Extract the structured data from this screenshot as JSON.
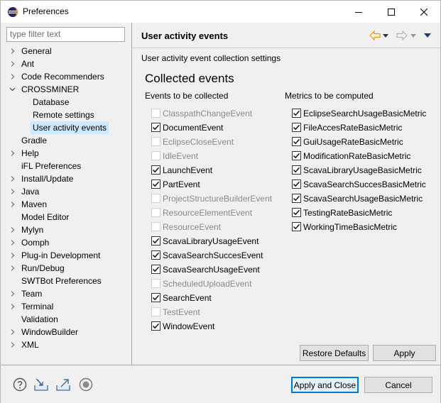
{
  "window": {
    "title": "Preferences",
    "min_symbol": "—",
    "max_symbol": "☐",
    "close_symbol": "✕"
  },
  "filter": {
    "placeholder": "type filter text"
  },
  "tree": {
    "items": [
      {
        "label": "General",
        "expander": "collapsed",
        "level": 0
      },
      {
        "label": "Ant",
        "expander": "collapsed",
        "level": 0
      },
      {
        "label": "Code Recommenders",
        "expander": "collapsed",
        "level": 0
      },
      {
        "label": "CROSSMINER",
        "expander": "expanded",
        "level": 0
      },
      {
        "label": "Database",
        "expander": "none",
        "level": 1
      },
      {
        "label": "Remote settings",
        "expander": "none",
        "level": 1
      },
      {
        "label": "User activity events",
        "expander": "none",
        "level": 1,
        "selected": true
      },
      {
        "label": "Gradle",
        "expander": "none",
        "level": 0
      },
      {
        "label": "Help",
        "expander": "collapsed",
        "level": 0
      },
      {
        "label": "iFL Preferences",
        "expander": "none",
        "level": 0
      },
      {
        "label": "Install/Update",
        "expander": "collapsed",
        "level": 0
      },
      {
        "label": "Java",
        "expander": "collapsed",
        "level": 0
      },
      {
        "label": "Maven",
        "expander": "collapsed",
        "level": 0
      },
      {
        "label": "Model Editor",
        "expander": "none",
        "level": 0
      },
      {
        "label": "Mylyn",
        "expander": "collapsed",
        "level": 0
      },
      {
        "label": "Oomph",
        "expander": "collapsed",
        "level": 0
      },
      {
        "label": "Plug-in Development",
        "expander": "collapsed",
        "level": 0
      },
      {
        "label": "Run/Debug",
        "expander": "collapsed",
        "level": 0
      },
      {
        "label": "SWTBot Preferences",
        "expander": "none",
        "level": 0
      },
      {
        "label": "Team",
        "expander": "collapsed",
        "level": 0
      },
      {
        "label": "Terminal",
        "expander": "collapsed",
        "level": 0
      },
      {
        "label": "Validation",
        "expander": "none",
        "level": 0
      },
      {
        "label": "WindowBuilder",
        "expander": "collapsed",
        "level": 0
      },
      {
        "label": "XML",
        "expander": "collapsed",
        "level": 0
      }
    ]
  },
  "page": {
    "title": "User activity events",
    "description": "User activity event collection settings",
    "group_title": "Collected events",
    "events_heading": "Events to be collected",
    "metrics_heading": "Metrics to be computed",
    "events": [
      {
        "label": "ClasspathChangeEvent",
        "checked": false,
        "enabled": false
      },
      {
        "label": "DocumentEvent",
        "checked": true,
        "enabled": true
      },
      {
        "label": "EclipseCloseEvent",
        "checked": false,
        "enabled": false
      },
      {
        "label": "IdleEvent",
        "checked": false,
        "enabled": false
      },
      {
        "label": "LaunchEvent",
        "checked": true,
        "enabled": true
      },
      {
        "label": "PartEvent",
        "checked": true,
        "enabled": true
      },
      {
        "label": "ProjectStructureBuilderEvent",
        "checked": false,
        "enabled": false
      },
      {
        "label": "ResourceElementEvent",
        "checked": false,
        "enabled": false
      },
      {
        "label": "ResourceEvent",
        "checked": false,
        "enabled": false
      },
      {
        "label": "ScavaLibraryUsageEvent",
        "checked": true,
        "enabled": true
      },
      {
        "label": "ScavaSearchSuccesEvent",
        "checked": true,
        "enabled": true
      },
      {
        "label": "ScavaSearchUsageEvent",
        "checked": true,
        "enabled": true
      },
      {
        "label": "ScheduledUploadEvent",
        "checked": false,
        "enabled": false
      },
      {
        "label": "SearchEvent",
        "checked": true,
        "enabled": true
      },
      {
        "label": "TestEvent",
        "checked": false,
        "enabled": false
      },
      {
        "label": "WindowEvent",
        "checked": true,
        "enabled": true
      }
    ],
    "metrics": [
      {
        "label": "EclipseSearchUsageBasicMetric",
        "checked": true,
        "enabled": true
      },
      {
        "label": "FileAccesRateBasicMetric",
        "checked": true,
        "enabled": true
      },
      {
        "label": "GuiUsageRateBasicMetric",
        "checked": true,
        "enabled": true
      },
      {
        "label": "ModificationRateBasicMetric",
        "checked": true,
        "enabled": true
      },
      {
        "label": "ScavaLibraryUsageBasicMetric",
        "checked": true,
        "enabled": true
      },
      {
        "label": "ScavaSearchSuccesBasicMetric",
        "checked": true,
        "enabled": true
      },
      {
        "label": "ScavaSearchUsageBasicMetric",
        "checked": true,
        "enabled": true
      },
      {
        "label": "TestingRateBasicMetric",
        "checked": true,
        "enabled": true
      },
      {
        "label": "WorkingTimeBasicMetric",
        "checked": true,
        "enabled": true
      }
    ],
    "restore_defaults_label": "Restore Defaults",
    "apply_label": "Apply"
  },
  "footer": {
    "apply_close_label": "Apply and Close",
    "cancel_label": "Cancel"
  },
  "colors": {
    "selection": "#cce8ff",
    "accent": "#0078d7",
    "nav_arrow": "#e8a317"
  }
}
